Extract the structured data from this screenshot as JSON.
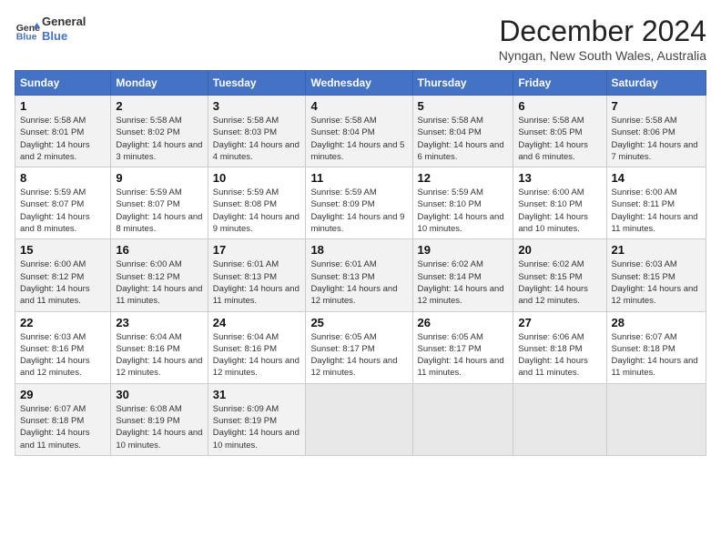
{
  "header": {
    "logo_line1": "General",
    "logo_line2": "Blue",
    "month_title": "December 2024",
    "location": "Nyngan, New South Wales, Australia"
  },
  "days_of_week": [
    "Sunday",
    "Monday",
    "Tuesday",
    "Wednesday",
    "Thursday",
    "Friday",
    "Saturday"
  ],
  "weeks": [
    [
      {
        "day": "1",
        "sunrise": "5:58 AM",
        "sunset": "8:01 PM",
        "daylight": "14 hours and 2 minutes."
      },
      {
        "day": "2",
        "sunrise": "5:58 AM",
        "sunset": "8:02 PM",
        "daylight": "14 hours and 3 minutes."
      },
      {
        "day": "3",
        "sunrise": "5:58 AM",
        "sunset": "8:03 PM",
        "daylight": "14 hours and 4 minutes."
      },
      {
        "day": "4",
        "sunrise": "5:58 AM",
        "sunset": "8:04 PM",
        "daylight": "14 hours and 5 minutes."
      },
      {
        "day": "5",
        "sunrise": "5:58 AM",
        "sunset": "8:04 PM",
        "daylight": "14 hours and 6 minutes."
      },
      {
        "day": "6",
        "sunrise": "5:58 AM",
        "sunset": "8:05 PM",
        "daylight": "14 hours and 6 minutes."
      },
      {
        "day": "7",
        "sunrise": "5:58 AM",
        "sunset": "8:06 PM",
        "daylight": "14 hours and 7 minutes."
      }
    ],
    [
      {
        "day": "8",
        "sunrise": "5:59 AM",
        "sunset": "8:07 PM",
        "daylight": "14 hours and 8 minutes."
      },
      {
        "day": "9",
        "sunrise": "5:59 AM",
        "sunset": "8:07 PM",
        "daylight": "14 hours and 8 minutes."
      },
      {
        "day": "10",
        "sunrise": "5:59 AM",
        "sunset": "8:08 PM",
        "daylight": "14 hours and 9 minutes."
      },
      {
        "day": "11",
        "sunrise": "5:59 AM",
        "sunset": "8:09 PM",
        "daylight": "14 hours and 9 minutes."
      },
      {
        "day": "12",
        "sunrise": "5:59 AM",
        "sunset": "8:10 PM",
        "daylight": "14 hours and 10 minutes."
      },
      {
        "day": "13",
        "sunrise": "6:00 AM",
        "sunset": "8:10 PM",
        "daylight": "14 hours and 10 minutes."
      },
      {
        "day": "14",
        "sunrise": "6:00 AM",
        "sunset": "8:11 PM",
        "daylight": "14 hours and 11 minutes."
      }
    ],
    [
      {
        "day": "15",
        "sunrise": "6:00 AM",
        "sunset": "8:12 PM",
        "daylight": "14 hours and 11 minutes."
      },
      {
        "day": "16",
        "sunrise": "6:00 AM",
        "sunset": "8:12 PM",
        "daylight": "14 hours and 11 minutes."
      },
      {
        "day": "17",
        "sunrise": "6:01 AM",
        "sunset": "8:13 PM",
        "daylight": "14 hours and 11 minutes."
      },
      {
        "day": "18",
        "sunrise": "6:01 AM",
        "sunset": "8:13 PM",
        "daylight": "14 hours and 12 minutes."
      },
      {
        "day": "19",
        "sunrise": "6:02 AM",
        "sunset": "8:14 PM",
        "daylight": "14 hours and 12 minutes."
      },
      {
        "day": "20",
        "sunrise": "6:02 AM",
        "sunset": "8:15 PM",
        "daylight": "14 hours and 12 minutes."
      },
      {
        "day": "21",
        "sunrise": "6:03 AM",
        "sunset": "8:15 PM",
        "daylight": "14 hours and 12 minutes."
      }
    ],
    [
      {
        "day": "22",
        "sunrise": "6:03 AM",
        "sunset": "8:16 PM",
        "daylight": "14 hours and 12 minutes."
      },
      {
        "day": "23",
        "sunrise": "6:04 AM",
        "sunset": "8:16 PM",
        "daylight": "14 hours and 12 minutes."
      },
      {
        "day": "24",
        "sunrise": "6:04 AM",
        "sunset": "8:16 PM",
        "daylight": "14 hours and 12 minutes."
      },
      {
        "day": "25",
        "sunrise": "6:05 AM",
        "sunset": "8:17 PM",
        "daylight": "14 hours and 12 minutes."
      },
      {
        "day": "26",
        "sunrise": "6:05 AM",
        "sunset": "8:17 PM",
        "daylight": "14 hours and 11 minutes."
      },
      {
        "day": "27",
        "sunrise": "6:06 AM",
        "sunset": "8:18 PM",
        "daylight": "14 hours and 11 minutes."
      },
      {
        "day": "28",
        "sunrise": "6:07 AM",
        "sunset": "8:18 PM",
        "daylight": "14 hours and 11 minutes."
      }
    ],
    [
      {
        "day": "29",
        "sunrise": "6:07 AM",
        "sunset": "8:18 PM",
        "daylight": "14 hours and 11 minutes."
      },
      {
        "day": "30",
        "sunrise": "6:08 AM",
        "sunset": "8:19 PM",
        "daylight": "14 hours and 10 minutes."
      },
      {
        "day": "31",
        "sunrise": "6:09 AM",
        "sunset": "8:19 PM",
        "daylight": "14 hours and 10 minutes."
      },
      null,
      null,
      null,
      null
    ]
  ]
}
